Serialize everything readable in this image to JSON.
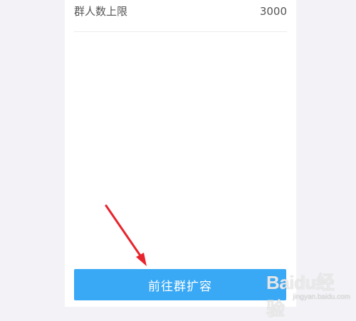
{
  "group_info": {
    "member_limit_label": "群人数上限",
    "member_limit_value": "3000"
  },
  "actions": {
    "expand_button_label": "前往群扩容"
  },
  "watermark": {
    "logo": "Baidu经验",
    "url": "jingyan.baidu.com"
  },
  "colors": {
    "background": "#f3f3f7",
    "panel": "#ffffff",
    "button": "#3aa9f5",
    "annotation_arrow": "#e8242c"
  },
  "icons": {
    "annotation": "red-arrow-icon"
  }
}
